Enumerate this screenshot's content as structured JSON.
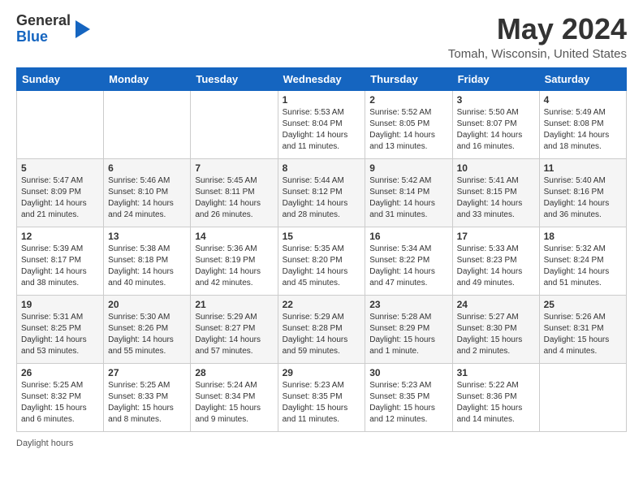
{
  "logo": {
    "general": "General",
    "blue": "Blue"
  },
  "header": {
    "month_title": "May 2024",
    "location": "Tomah, Wisconsin, United States"
  },
  "days_of_week": [
    "Sunday",
    "Monday",
    "Tuesday",
    "Wednesday",
    "Thursday",
    "Friday",
    "Saturday"
  ],
  "weeks": [
    [
      {
        "day": "",
        "info": ""
      },
      {
        "day": "",
        "info": ""
      },
      {
        "day": "",
        "info": ""
      },
      {
        "day": "1",
        "info": "Sunrise: 5:53 AM\nSunset: 8:04 PM\nDaylight: 14 hours and 11 minutes."
      },
      {
        "day": "2",
        "info": "Sunrise: 5:52 AM\nSunset: 8:05 PM\nDaylight: 14 hours and 13 minutes."
      },
      {
        "day": "3",
        "info": "Sunrise: 5:50 AM\nSunset: 8:07 PM\nDaylight: 14 hours and 16 minutes."
      },
      {
        "day": "4",
        "info": "Sunrise: 5:49 AM\nSunset: 8:08 PM\nDaylight: 14 hours and 18 minutes."
      }
    ],
    [
      {
        "day": "5",
        "info": "Sunrise: 5:47 AM\nSunset: 8:09 PM\nDaylight: 14 hours and 21 minutes."
      },
      {
        "day": "6",
        "info": "Sunrise: 5:46 AM\nSunset: 8:10 PM\nDaylight: 14 hours and 24 minutes."
      },
      {
        "day": "7",
        "info": "Sunrise: 5:45 AM\nSunset: 8:11 PM\nDaylight: 14 hours and 26 minutes."
      },
      {
        "day": "8",
        "info": "Sunrise: 5:44 AM\nSunset: 8:12 PM\nDaylight: 14 hours and 28 minutes."
      },
      {
        "day": "9",
        "info": "Sunrise: 5:42 AM\nSunset: 8:14 PM\nDaylight: 14 hours and 31 minutes."
      },
      {
        "day": "10",
        "info": "Sunrise: 5:41 AM\nSunset: 8:15 PM\nDaylight: 14 hours and 33 minutes."
      },
      {
        "day": "11",
        "info": "Sunrise: 5:40 AM\nSunset: 8:16 PM\nDaylight: 14 hours and 36 minutes."
      }
    ],
    [
      {
        "day": "12",
        "info": "Sunrise: 5:39 AM\nSunset: 8:17 PM\nDaylight: 14 hours and 38 minutes."
      },
      {
        "day": "13",
        "info": "Sunrise: 5:38 AM\nSunset: 8:18 PM\nDaylight: 14 hours and 40 minutes."
      },
      {
        "day": "14",
        "info": "Sunrise: 5:36 AM\nSunset: 8:19 PM\nDaylight: 14 hours and 42 minutes."
      },
      {
        "day": "15",
        "info": "Sunrise: 5:35 AM\nSunset: 8:20 PM\nDaylight: 14 hours and 45 minutes."
      },
      {
        "day": "16",
        "info": "Sunrise: 5:34 AM\nSunset: 8:22 PM\nDaylight: 14 hours and 47 minutes."
      },
      {
        "day": "17",
        "info": "Sunrise: 5:33 AM\nSunset: 8:23 PM\nDaylight: 14 hours and 49 minutes."
      },
      {
        "day": "18",
        "info": "Sunrise: 5:32 AM\nSunset: 8:24 PM\nDaylight: 14 hours and 51 minutes."
      }
    ],
    [
      {
        "day": "19",
        "info": "Sunrise: 5:31 AM\nSunset: 8:25 PM\nDaylight: 14 hours and 53 minutes."
      },
      {
        "day": "20",
        "info": "Sunrise: 5:30 AM\nSunset: 8:26 PM\nDaylight: 14 hours and 55 minutes."
      },
      {
        "day": "21",
        "info": "Sunrise: 5:29 AM\nSunset: 8:27 PM\nDaylight: 14 hours and 57 minutes."
      },
      {
        "day": "22",
        "info": "Sunrise: 5:29 AM\nSunset: 8:28 PM\nDaylight: 14 hours and 59 minutes."
      },
      {
        "day": "23",
        "info": "Sunrise: 5:28 AM\nSunset: 8:29 PM\nDaylight: 15 hours and 1 minute."
      },
      {
        "day": "24",
        "info": "Sunrise: 5:27 AM\nSunset: 8:30 PM\nDaylight: 15 hours and 2 minutes."
      },
      {
        "day": "25",
        "info": "Sunrise: 5:26 AM\nSunset: 8:31 PM\nDaylight: 15 hours and 4 minutes."
      }
    ],
    [
      {
        "day": "26",
        "info": "Sunrise: 5:25 AM\nSunset: 8:32 PM\nDaylight: 15 hours and 6 minutes."
      },
      {
        "day": "27",
        "info": "Sunrise: 5:25 AM\nSunset: 8:33 PM\nDaylight: 15 hours and 8 minutes."
      },
      {
        "day": "28",
        "info": "Sunrise: 5:24 AM\nSunset: 8:34 PM\nDaylight: 15 hours and 9 minutes."
      },
      {
        "day": "29",
        "info": "Sunrise: 5:23 AM\nSunset: 8:35 PM\nDaylight: 15 hours and 11 minutes."
      },
      {
        "day": "30",
        "info": "Sunrise: 5:23 AM\nSunset: 8:35 PM\nDaylight: 15 hours and 12 minutes."
      },
      {
        "day": "31",
        "info": "Sunrise: 5:22 AM\nSunset: 8:36 PM\nDaylight: 15 hours and 14 minutes."
      },
      {
        "day": "",
        "info": ""
      }
    ]
  ],
  "footer": {
    "label": "Daylight hours"
  }
}
